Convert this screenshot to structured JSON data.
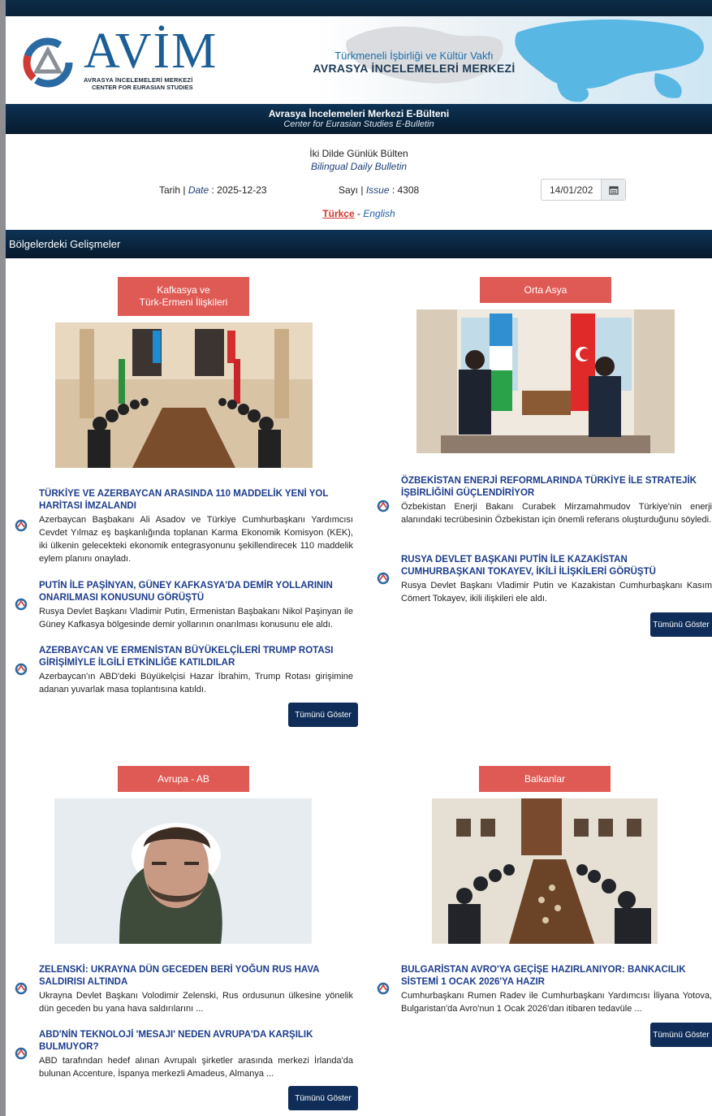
{
  "header": {
    "logo_name": "AVİM",
    "logo_sub1": "AVRASYA İNCELEMELERİ MERKEZİ",
    "logo_sub2": "CENTER FOR EURASIAN STUDIES",
    "foundation": "Türkmeneli İşbirliği ve Kültür Vakfı",
    "center_name": "AVRASYA İNCELEMELERİ MERKEZİ"
  },
  "bulletin": {
    "title_tr": "Avrasya İncelemeleri Merkezi E-Bülteni",
    "title_en": "Center for Eurasian Studies E-Bulletin",
    "daily_tr": "İki Dilde Günlük Bülten",
    "daily_en": "Bilingual Daily Bulletin",
    "date_label_tr": "Tarih |",
    "date_label_en": "Date",
    "date_value": ": 2025-12-23",
    "issue_label_tr": "Sayı |",
    "issue_label_en": "Issue",
    "issue_value": ": 4308",
    "date_picker_value": "14/01/202",
    "lang_tr": "Türkçe",
    "lang_sep": "-",
    "lang_en": "English"
  },
  "section_title": "Bölgelerdeki Gelişmeler",
  "show_all_label": "Tümünü Göster",
  "regions": [
    {
      "tag": "Kafkasya ve Türk-Ermeni İlişkileri",
      "tag_line1": "Kafkasya ve",
      "tag_line2": "Türk-Ermeni İlişkileri",
      "news": [
        {
          "title": "TÜRKİYE VE AZERBAYCAN ARASINDA 110 MADDELİK YENİ YOL HARİTASI İMZALANDI",
          "summary": "Azerbaycan Başbakanı Ali Asadov ve Türkiye Cumhurbaşkanı Yardımcısı Cevdet Yılmaz eş başkanlığında toplanan Karma Ekonomik Komisyon (KEK), iki ülkenin gelecekteki ekonomik entegrasyonunu şekillendirecek 110 maddelik eylem planını onayladı."
        },
        {
          "title": "PUTİN İLE PAŞİNYAN, GÜNEY KAFKASYA'DA DEMİR YOLLARININ ONARILMASI KONUSUNU GÖRÜŞTÜ",
          "summary": " Rusya Devlet Başkanı Vladimir Putin, Ermenistan Başbakanı Nikol Paşinyan ile Güney Kafkasya bölgesinde demir yollarının onarılması konusunu ele aldı."
        },
        {
          "title": "AZERBAYCAN VE ERMENİSTAN BÜYÜKELÇİLERİ TRUMP ROTASI GİRİŞİMİYLE İLGİLİ ETKİNLİĞE KATILDILAR",
          "summary": "Azerbaycan'ın ABD'deki Büyükelçisi Hazar İbrahim, Trump Rotası girişimine adanan yuvarlak masa toplantısına katıldı."
        }
      ]
    },
    {
      "tag": "Orta Asya",
      "news": [
        {
          "title": "ÖZBEKİSTAN ENERJİ REFORMLARINDA TÜRKİYE İLE STRATEJİK İŞBİRLİĞİNİ GÜÇLENDİRİYOR",
          "summary": "Özbekistan Enerji Bakanı Curabek Mirzamahmudov Türkiye'nin enerji alanındaki tecrübesinin Özbekistan için önemli referans oluşturduğunu söyledi."
        },
        {
          "title": "RUSYA DEVLET BAŞKANI PUTİN İLE KAZAKİSTAN CUMHURBAŞKANI TOKAYEV, İKİLİ İLİŞKİLERİ GÖRÜŞTÜ",
          "summary": "Rusya Devlet Başkanı Vladimir Putin ve Kazakistan Cumhurbaşkanı Kasım Cömert Tokayev, ikili ilişkileri ele aldı."
        }
      ]
    },
    {
      "tag": "Avrupa - AB",
      "news": [
        {
          "title": "ZELENSKİ: UKRAYNA DÜN GECEDEN BERİ YOĞUN RUS HAVA SALDIRISI ALTINDA",
          "summary": "Ukrayna Devlet Başkanı Volodimir Zelenski, Rus ordusunun ülkesine yönelik dün geceden bu yana hava saldırılarını ..."
        },
        {
          "title": "ABD'NİN TEKNOLOJİ 'MESAJI' NEDEN AVRUPA'DA KARŞILIK BULMUYOR?",
          "summary": "ABD tarafından hedef alınan Avrupalı şirketler arasında merkezi İrlanda'da bulunan Accenture, İspanya merkezli Amadeus, Almanya ..."
        }
      ]
    },
    {
      "tag": "Balkanlar",
      "news": [
        {
          "title": "BULGARİSTAN AVRO'YA GEÇİŞE HAZIRLANIYOR: BANKACILIK SİSTEMİ 1 OCAK 2026'YA HAZIR",
          "summary": "Cumhurbaşkanı Rumen Radev ile Cumhurbaşkanı Yardımcısı İliyana Yotova, Bulgaristan'da Avro'nun 1 Ocak 2026'dan itibaren tedavüle ..."
        }
      ]
    }
  ]
}
